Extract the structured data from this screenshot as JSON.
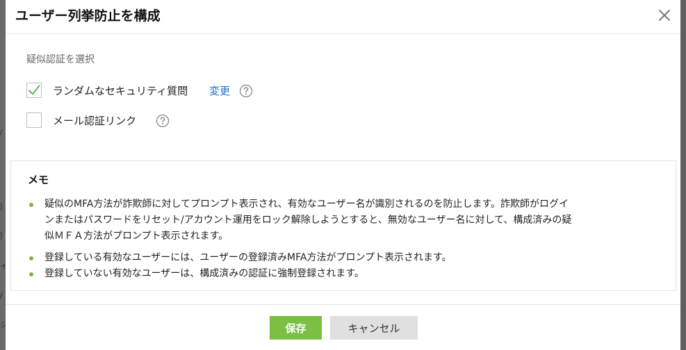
{
  "dialog": {
    "title": "ユーザー列挙防止を構成"
  },
  "fake_auth": {
    "label": "疑似認証を選択",
    "options": [
      {
        "label": "ランダムなセキュリティ質問",
        "checked": true,
        "change_link": "変更"
      },
      {
        "label": "メール認証リンク",
        "checked": false
      }
    ]
  },
  "memo": {
    "title": "メモ",
    "items": [
      {
        "line1": "疑似のMFA方法が詐欺師に対してプロンプト表示され、有効なユーザー名が識別されるのを防止します。詐欺師がログイ",
        "line2": "ンまたはパスワードをリセット/アカウント運用をロック解除しようとすると、無効なユーザー名に対して、構成済みの疑",
        "line3": "似ＭＦＡ方法がプロンプト表示されます。"
      },
      {
        "text": "登録している有効なユーザーには、ユーザーの登録済みMFA方法がプロンプト表示されます。"
      },
      {
        "text": "登録していない有効なユーザーは、構成済みの認証に強制登録されます。"
      }
    ]
  },
  "footer": {
    "save_label": "保存",
    "cancel_label": "キャンセル"
  },
  "colors": {
    "accent": "#7cbf45",
    "link": "#1a73c9",
    "check": "#5cb85c"
  },
  "icons": {
    "close": "close-icon",
    "help": "question-circle-icon",
    "check": "checkmark-icon"
  }
}
